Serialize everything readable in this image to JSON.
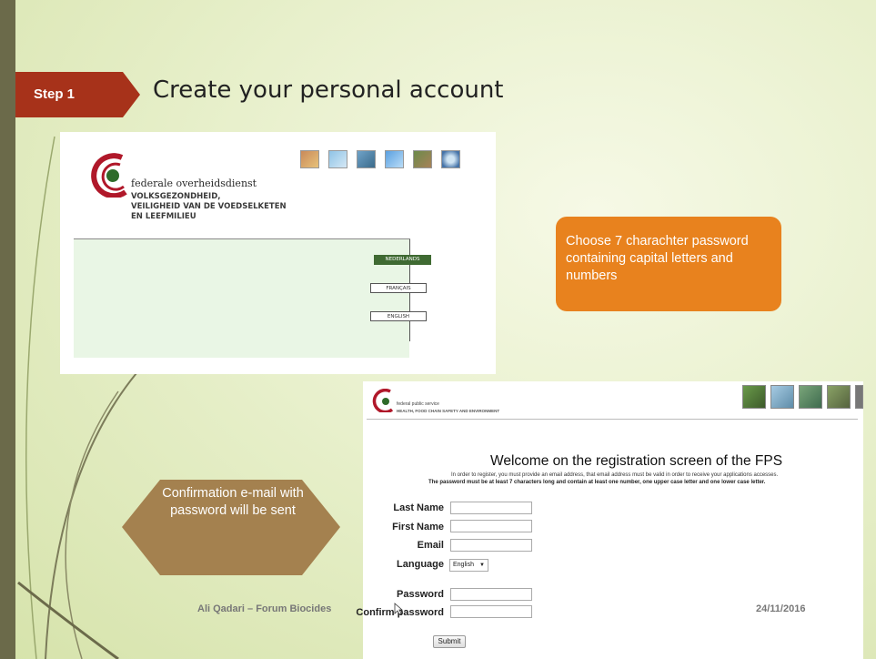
{
  "slide": {
    "step_label": "Step 1",
    "title": "Create your personal account",
    "footer_author": "Ali Qadari – Forum Biocides",
    "footer_date": "24/11/2016",
    "colors": {
      "step_tag": "#a7321a",
      "orange_callout": "#e8821e",
      "brown_callout": "#a4814f",
      "left_bar": "#6b6a4a"
    }
  },
  "screenshot_nl": {
    "org_line1": "federale overheidsdienst",
    "org_line2": "VOLKSGEZONDHEID,",
    "org_line3": "VEILIGHEID VAN DE VOEDSELKETEN",
    "org_line4": "EN LEEFMILIEU",
    "languages": [
      "NEDERLANDS",
      "FRANÇAIS",
      "ENGLISH"
    ],
    "header_photos": [
      "child-photo",
      "water-photo",
      "lab-photo",
      "sky-photo",
      "horse-photo",
      "globe-photo"
    ]
  },
  "callouts": {
    "password_tip": "Choose  7 charachter password containing capital letters and numbers",
    "confirmation": "Confirmation e-mail with password will be sent"
  },
  "screenshot_fps": {
    "org_line1": "federal public service",
    "org_line2": "HEALTH, FOOD CHAIN SAFETY AND ENVIRONMENT",
    "welcome": "Welcome on the registration screen of the FPS",
    "note1": "In order to register, you must provide an email address, that email address must be valid in order to receive your applications accesses.",
    "note2": "The password must be at least 7 characters long and contain at least one number, one upper case letter and one lower case letter.",
    "fields": {
      "last_name": "Last Name",
      "first_name": "First Name",
      "email": "Email",
      "language": "Language",
      "password": "Password",
      "confirm_password": "Confirm password"
    },
    "language_selected": "English",
    "submit": "Submit"
  }
}
